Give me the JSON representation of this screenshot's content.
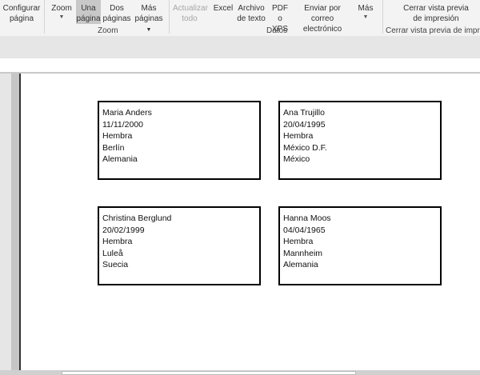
{
  "ribbon": {
    "configurar": "Configurar página",
    "zoom_group": {
      "label": "Zoom",
      "zoom": "Zoom",
      "una_pagina": "Una página",
      "dos_paginas": "Dos páginas",
      "mas_paginas": "Más páginas"
    },
    "datos_group": {
      "label": "Datos",
      "actualizar": "Actualizar todo",
      "excel": "Excel",
      "archivo_texto": "Archivo de texto",
      "pdf": "PDF o XPS",
      "correo": "Enviar por correo electrónico",
      "mas": "Más"
    },
    "cerrar_group": {
      "label": "Cerrar vista previa de impresión",
      "cerrar": "Cerrar vista previa de impresión"
    }
  },
  "labels": [
    {
      "name": "Maria Anders",
      "date": "11/11/2000",
      "gender": "Hembra",
      "city": "Berlín",
      "country": "Alemania"
    },
    {
      "name": "Ana Trujillo",
      "date": "20/04/1995",
      "gender": "Hembra",
      "city": "México D.F.",
      "country": "México"
    },
    {
      "name": "Christina Berglund",
      "date": "20/02/1999",
      "gender": "Hembra",
      "city": "Luleå",
      "country": "Suecia"
    },
    {
      "name": "Hanna Moos",
      "date": "04/04/1965",
      "gender": "Hembra",
      "city": "Mannheim",
      "country": "Alemania"
    }
  ]
}
